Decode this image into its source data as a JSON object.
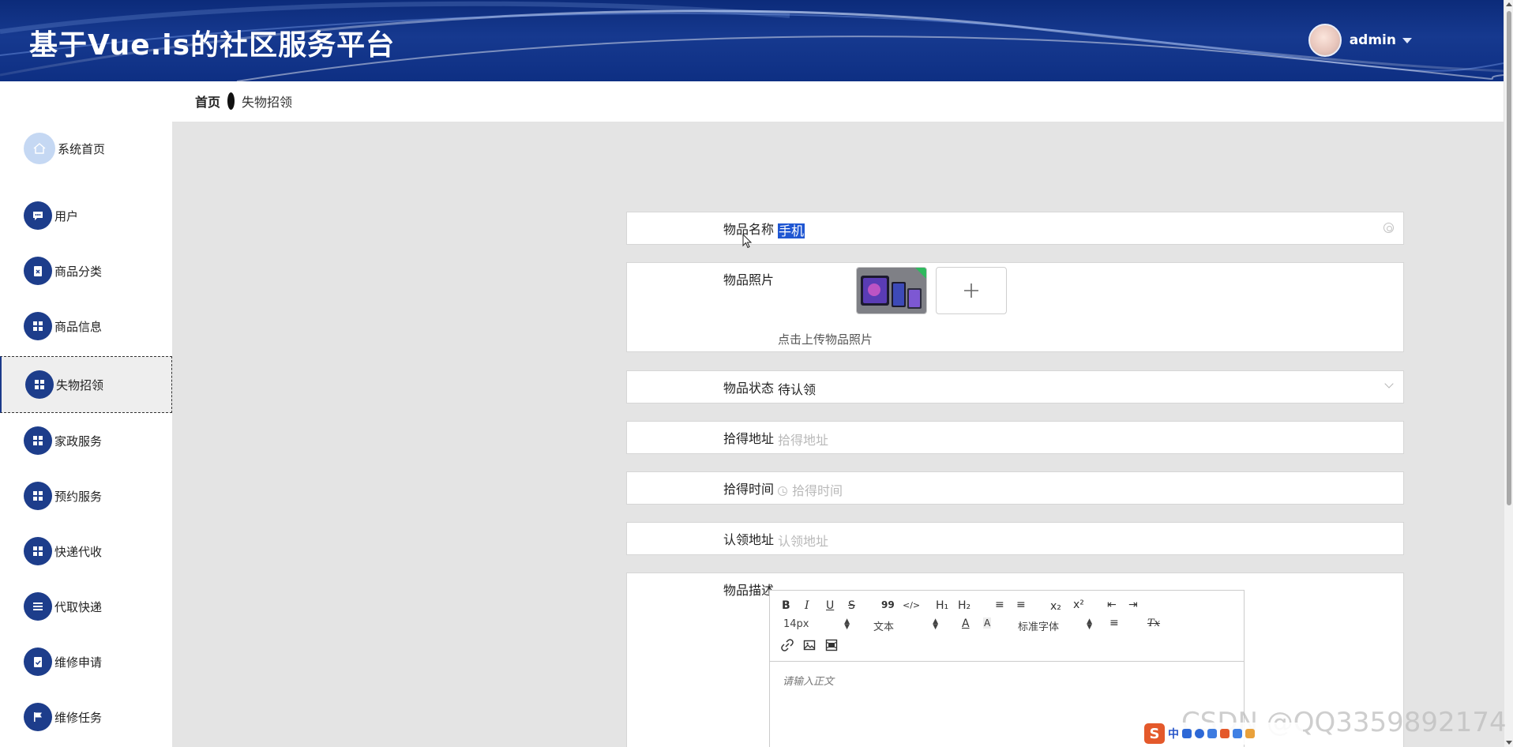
{
  "header": {
    "title": "基于Vue.is的社区服务平台",
    "username": "admin"
  },
  "breadcrumb": {
    "home": "首页",
    "current": "失物招领"
  },
  "sidebar": {
    "items": [
      {
        "label": "系统首页",
        "icon": "home-icon"
      },
      {
        "label": "用户",
        "icon": "chat-icon"
      },
      {
        "label": "商品分类",
        "icon": "clipboard-x-icon"
      },
      {
        "label": "商品信息",
        "icon": "grid-icon"
      },
      {
        "label": "失物招领",
        "icon": "grid-icon",
        "active": true
      },
      {
        "label": "家政服务",
        "icon": "grid-icon"
      },
      {
        "label": "预约服务",
        "icon": "grid-icon"
      },
      {
        "label": "快递代收",
        "icon": "grid-icon"
      },
      {
        "label": "代取快递",
        "icon": "list-icon"
      },
      {
        "label": "维修申请",
        "icon": "clipboard-check-icon"
      },
      {
        "label": "维修任务",
        "icon": "flag-icon"
      }
    ]
  },
  "form": {
    "name": {
      "label": "物品名称",
      "value": "手机"
    },
    "photo": {
      "label": "物品照片",
      "hint": "点击上传物品照片"
    },
    "status": {
      "label": "物品状态",
      "value": "待认领"
    },
    "pickup_address": {
      "label": "拾得地址",
      "placeholder": "拾得地址"
    },
    "pickup_time": {
      "label": "拾得时间",
      "placeholder": "拾得时间"
    },
    "claim_address": {
      "label": "认领地址",
      "placeholder": "认领地址"
    },
    "description": {
      "label": "物品描述"
    }
  },
  "editor": {
    "toolbar": {
      "bold": "B",
      "italic": "I",
      "underline": "U",
      "strike": "S",
      "quote": "99",
      "code": "</>",
      "h1": "H₁",
      "h2": "H₂",
      "ordered_list": "≡",
      "bullet_list": "≡",
      "sub": "x₂",
      "sup": "x²",
      "outdent": "⇤",
      "indent": "⇥",
      "font_size": "14px",
      "header": "文本",
      "font_family": "标准字体",
      "color": "A",
      "background": "A",
      "align": "≡",
      "clean": "Tx"
    },
    "placeholder": "请输入正文"
  },
  "watermark": "CSDN @QQ3359892174",
  "ime": {
    "lang": "中"
  },
  "colors": {
    "header_bg": "#16398f",
    "nav_icon_bg": "#1d3d8b",
    "main_bg": "#e4e4e4",
    "selection": "#1f56d2"
  }
}
